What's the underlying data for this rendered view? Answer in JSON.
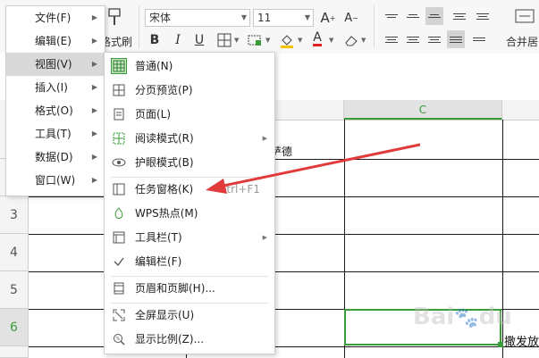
{
  "ribbon": {
    "format_painter_label": "格式刷",
    "font_name": "宋体",
    "font_size": "11",
    "merge_label": "合并居"
  },
  "grid": {
    "col_c": "C",
    "rows": [
      "3",
      "4",
      "5",
      "6"
    ],
    "cell_b2_text": "萨德",
    "cell_d6_text": "撒发放"
  },
  "menu": {
    "items": [
      {
        "label": "文件(F)"
      },
      {
        "label": "编辑(E)"
      },
      {
        "label": "视图(V)"
      },
      {
        "label": "插入(I)"
      },
      {
        "label": "格式(O)"
      },
      {
        "label": "工具(T)"
      },
      {
        "label": "数据(D)"
      },
      {
        "label": "窗口(W)"
      }
    ]
  },
  "view_menu": {
    "items": [
      {
        "label": "普通(N)",
        "icon": "normal-view-icon"
      },
      {
        "label": "分页预览(P)",
        "icon": "page-break-preview-icon"
      },
      {
        "label": "页面(L)",
        "icon": "page-layout-icon"
      },
      {
        "label": "阅读模式(R)",
        "icon": "reading-mode-icon"
      },
      {
        "label": "护眼模式(B)",
        "icon": "eye-protection-icon"
      },
      {
        "label": "任务窗格(K)",
        "icon": "task-pane-icon",
        "shortcut": "Ctrl+F1"
      },
      {
        "label": "WPS热点(M)",
        "icon": "wps-hotspot-icon"
      },
      {
        "label": "工具栏(T)",
        "icon": "toolbar-icon"
      },
      {
        "label": "编辑栏(F)",
        "icon": "checkmark-icon"
      },
      {
        "label": "页眉和页脚(H)...",
        "icon": "header-footer-icon"
      },
      {
        "label": "全屏显示(U)",
        "icon": "fullscreen-icon"
      },
      {
        "label": "显示比例(Z)...",
        "icon": "zoom-icon"
      }
    ]
  },
  "colors": {
    "accent_green": "#3a9b3a",
    "arrow_red": "#e03a3a",
    "menu_highlight": "#d9d9d9"
  }
}
